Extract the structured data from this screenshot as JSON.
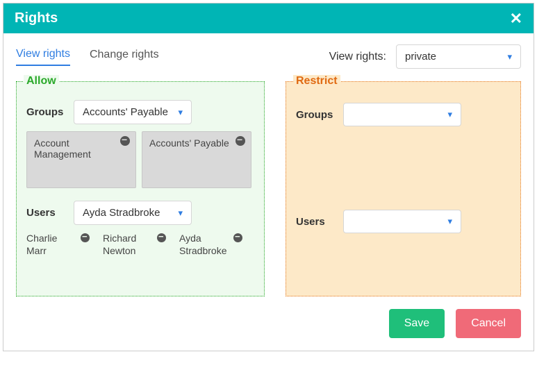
{
  "title": "Rights",
  "tabs": {
    "view": "View rights",
    "change": "Change rights",
    "active": "view"
  },
  "scope": {
    "label": "View rights:",
    "value": "private"
  },
  "allow": {
    "title": "Allow",
    "groups_label": "Groups",
    "groups_selected": "Accounts' Payable",
    "groups_chips": [
      "Account Management",
      "Accounts' Payable"
    ],
    "users_label": "Users",
    "users_selected": "Ayda Stradbroke",
    "users_chips": [
      "Charlie Marr",
      "Richard Newton",
      "Ayda Stradbroke"
    ]
  },
  "restrict": {
    "title": "Restrict",
    "groups_label": "Groups",
    "groups_selected": "",
    "users_label": "Users",
    "users_selected": ""
  },
  "buttons": {
    "save": "Save",
    "cancel": "Cancel"
  }
}
